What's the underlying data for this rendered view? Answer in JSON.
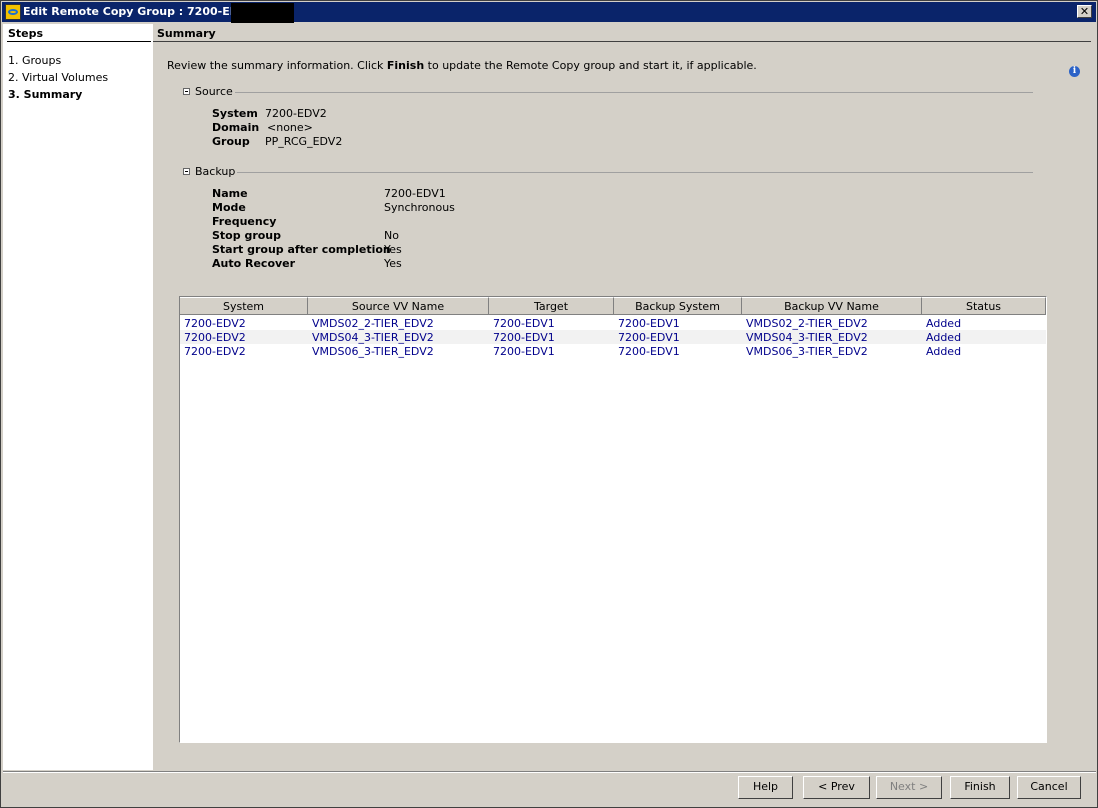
{
  "window": {
    "title": "Edit Remote Copy Group : 7200-EDV2",
    "close_glyph": "✕"
  },
  "steps": {
    "heading": "Steps",
    "items": [
      "1. Groups",
      "2. Virtual Volumes",
      "3. Summary"
    ],
    "current_index": 2
  },
  "summary": {
    "heading": "Summary",
    "intro_prefix": "Review the summary information. Click ",
    "intro_bold": "Finish",
    "intro_suffix": " to update the Remote Copy group and start it, if applicable.",
    "info_icon": "i"
  },
  "source": {
    "heading": "Source",
    "fields": [
      {
        "label": "System",
        "value": "7200-EDV2"
      },
      {
        "label": "Domain",
        "value": "<none>"
      },
      {
        "label": "Group",
        "value": "PP_RCG_EDV2"
      }
    ]
  },
  "backup": {
    "heading": "Backup",
    "fields": [
      {
        "label": "Name",
        "value": "7200-EDV1"
      },
      {
        "label": "Mode",
        "value": "Synchronous"
      },
      {
        "label": "Frequency",
        "value": ""
      },
      {
        "label": "Stop group",
        "value": "No"
      },
      {
        "label": "Start group after completion",
        "value": "Yes"
      },
      {
        "label": "Auto Recover",
        "value": "Yes"
      }
    ]
  },
  "table": {
    "columns": [
      "System",
      "Source VV Name",
      "Target",
      "Backup System",
      "Backup VV Name",
      "Status"
    ],
    "rows": [
      [
        "7200-EDV2",
        "VMDS02_2-TIER_EDV2",
        "7200-EDV1",
        "7200-EDV1",
        "VMDS02_2-TIER_EDV2",
        "Added"
      ],
      [
        "7200-EDV2",
        "VMDS04_3-TIER_EDV2",
        "7200-EDV1",
        "7200-EDV1",
        "VMDS04_3-TIER_EDV2",
        "Added"
      ],
      [
        "7200-EDV2",
        "VMDS06_3-TIER_EDV2",
        "7200-EDV1",
        "7200-EDV1",
        "VMDS06_3-TIER_EDV2",
        "Added"
      ]
    ]
  },
  "buttons": {
    "help": "Help",
    "prev": "< Prev",
    "next": "Next >",
    "finish": "Finish",
    "cancel": "Cancel"
  }
}
